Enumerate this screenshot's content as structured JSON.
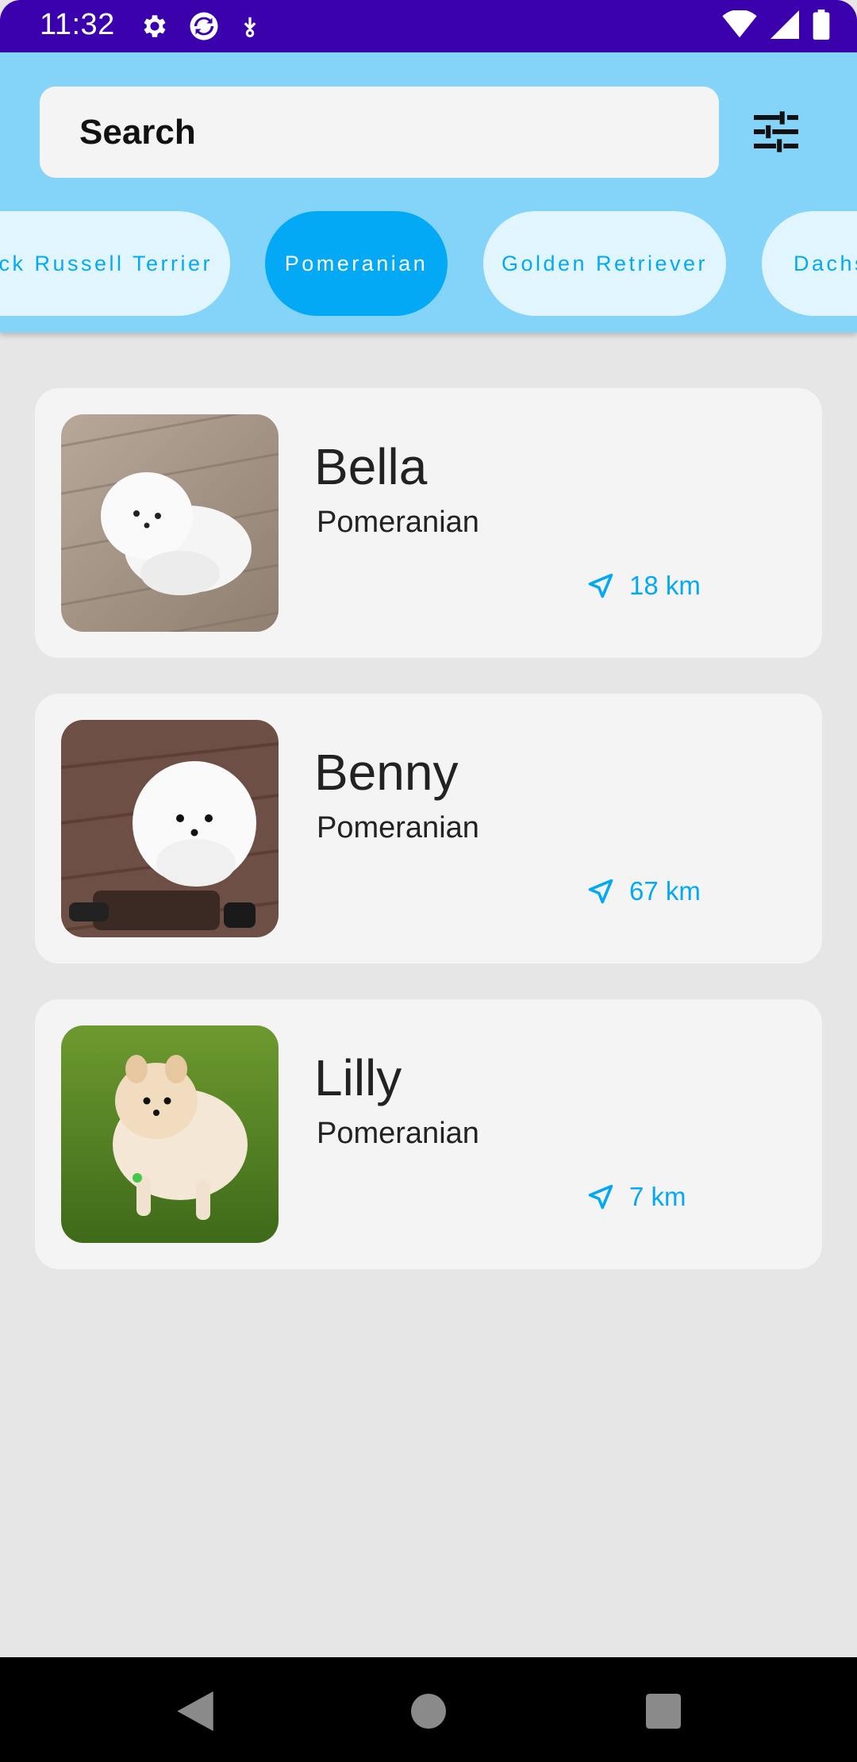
{
  "status_bar": {
    "time": "11:32",
    "left_icons": [
      "gear-icon",
      "sync-icon",
      "download-icon"
    ],
    "right_icons": [
      "wifi-icon",
      "signal-icon",
      "battery-icon"
    ]
  },
  "header": {
    "search": {
      "placeholder": "Search"
    },
    "filter_icon": "tune-icon",
    "breeds": [
      {
        "label": "Jack Russell Terrier",
        "selected": false
      },
      {
        "label": "Pomeranian",
        "selected": true
      },
      {
        "label": "Golden Retriever",
        "selected": false
      },
      {
        "label": "Dachshund",
        "selected": false
      }
    ]
  },
  "colors": {
    "status_bar": "#3b01ad",
    "header": "#84d4fa",
    "accent": "#03a9f4",
    "chip_bg": "#e1f5fe",
    "background": "#e6e6e6",
    "card": "#f4f4f4"
  },
  "dogs": [
    {
      "name": "Bella",
      "breed": "Pomeranian",
      "distance": "18 km"
    },
    {
      "name": "Benny",
      "breed": "Pomeranian",
      "distance": "67 km"
    },
    {
      "name": "Lilly",
      "breed": "Pomeranian",
      "distance": "7 km"
    }
  ],
  "nav": {
    "icons": [
      "back-icon",
      "home-icon",
      "recents-icon"
    ]
  }
}
